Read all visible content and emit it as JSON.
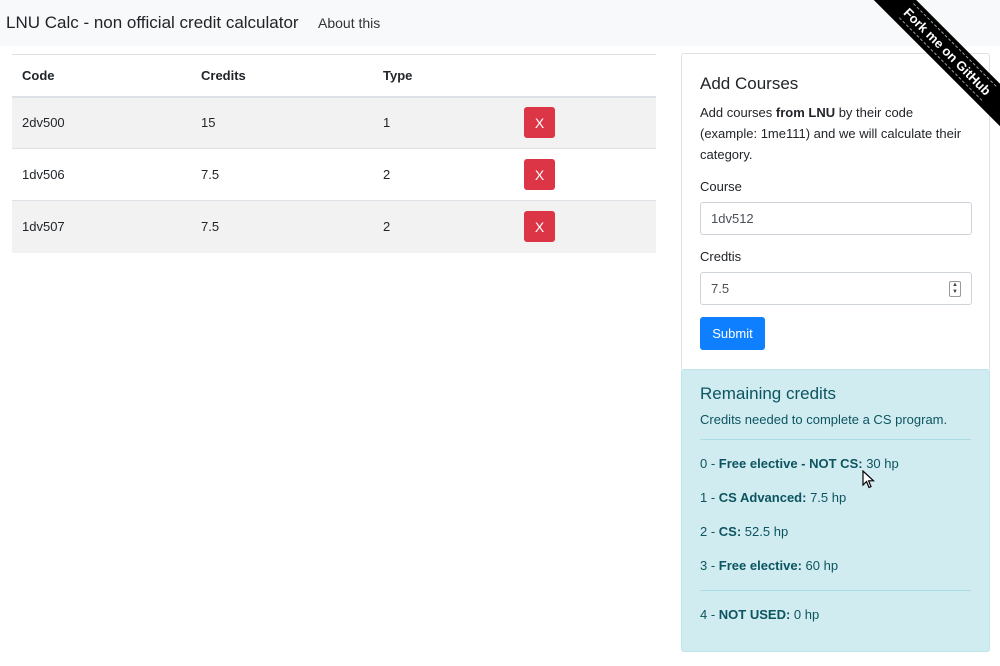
{
  "navbar": {
    "brand": "LNU Calc - non official credit calculator",
    "about": "About this"
  },
  "ribbon": {
    "text": "Fork me on GitHub"
  },
  "table": {
    "headers": [
      "Code",
      "Credits",
      "Type",
      ""
    ],
    "rows": [
      {
        "code": "2dv500",
        "credits": "15",
        "type": "1",
        "action": "X"
      },
      {
        "code": "1dv506",
        "credits": "7.5",
        "type": "2",
        "action": "X"
      },
      {
        "code": "1dv507",
        "credits": "7.5",
        "type": "2",
        "action": "X"
      }
    ]
  },
  "add_card": {
    "title": "Add Courses",
    "text_pre": "Add courses ",
    "text_bold": "from LNU",
    "text_post": " by their code (example: 1me111) and we will calculate their category.",
    "course_label": "Course",
    "course_value": "1dv512",
    "credits_label": "Credtis",
    "credits_value": "7.5",
    "submit": "Submit"
  },
  "remaining": {
    "title": "Remaining credits",
    "subtitle": "Credits needed to complete a CS program.",
    "categories": [
      {
        "num": "0 - ",
        "name": "Free elective - NOT CS:",
        "value": " 30 hp"
      },
      {
        "num": "1 - ",
        "name": "CS Advanced:",
        "value": " 7.5 hp"
      },
      {
        "num": "2 - ",
        "name": "CS:",
        "value": " 52.5 hp"
      },
      {
        "num": "3 - ",
        "name": "Free elective:",
        "value": " 60 hp"
      },
      {
        "num": "4 - ",
        "name": "NOT USED:",
        "value": " 0 hp"
      }
    ]
  },
  "colors": {
    "danger": "#dc3545",
    "primary": "#0d7fff",
    "info_bg": "#d1ecf1",
    "info_text": "#0c5460"
  }
}
